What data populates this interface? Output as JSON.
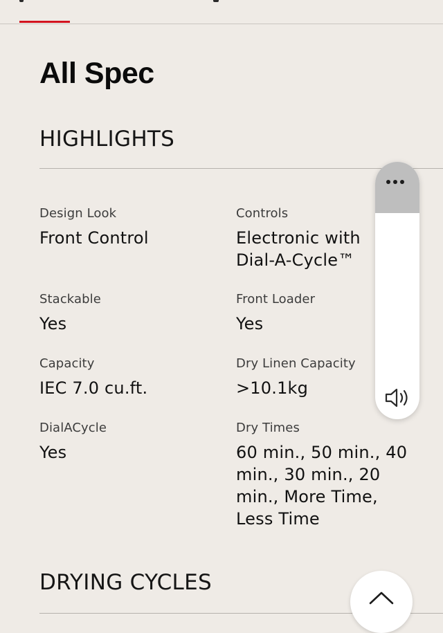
{
  "page": {
    "title": "All Spec"
  },
  "sections": [
    {
      "heading": "HIGHLIGHTS",
      "specs": [
        {
          "label": "Design Look",
          "value": "Front Control"
        },
        {
          "label": "Controls",
          "value": "Electronic with Dial-A-Cycle™"
        },
        {
          "label": "Stackable",
          "value": "Yes"
        },
        {
          "label": "Front Loader",
          "value": "Yes"
        },
        {
          "label": "Capacity",
          "value": "IEC 7.0 cu.ft."
        },
        {
          "label": "Dry Linen Capacity",
          "value": ">10.1kg"
        },
        {
          "label": "DialACycle",
          "value": "Yes"
        },
        {
          "label": "Dry Times",
          "value": "60 min., 50 min., 40 min., 30 min., 20 min., More Time, Less Time"
        }
      ]
    },
    {
      "heading": "DRYING CYCLES"
    }
  ],
  "volume_panel": {
    "more_icon": "more-horizontal-icon",
    "speaker_icon": "speaker-volume-icon"
  },
  "scroll_top_icon": "chevron-up-icon",
  "colors": {
    "accent": "#D3131F",
    "background": "#EFEBE6"
  }
}
